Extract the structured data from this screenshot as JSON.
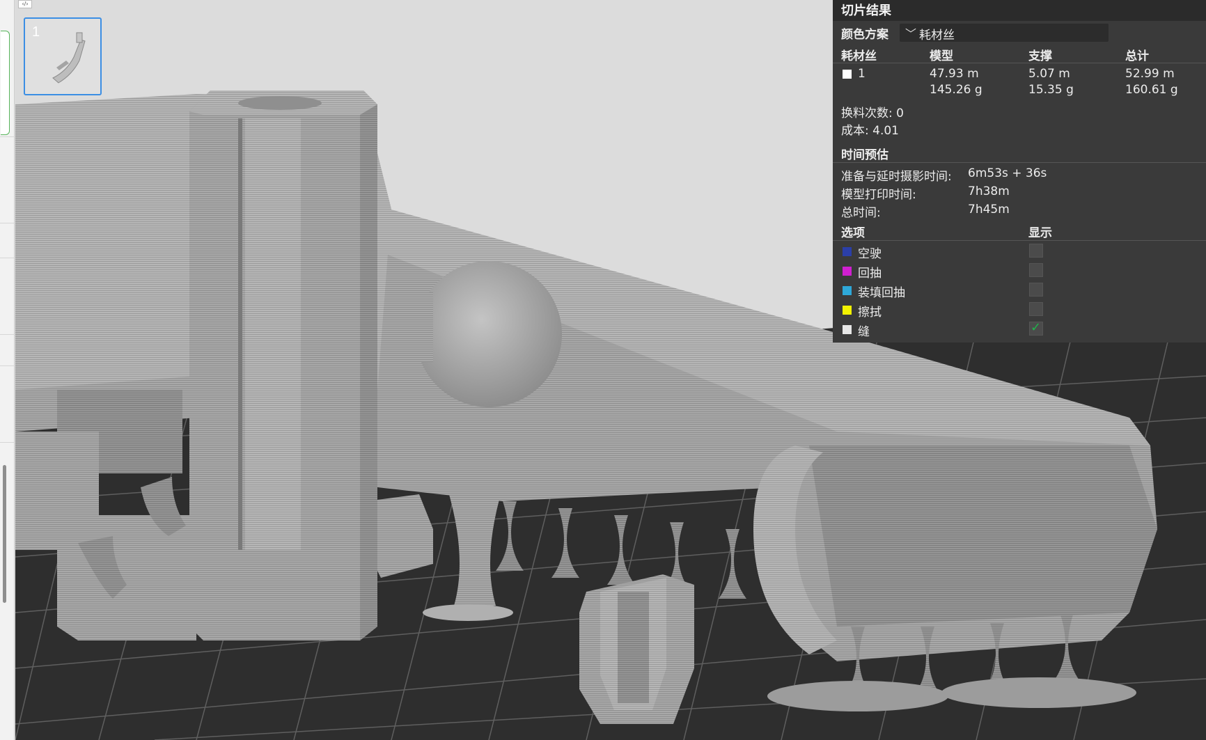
{
  "viewport": {
    "toggle_label": "‹/›",
    "plate_number": "1",
    "colors": {
      "background": "#dcdcdc",
      "bed": "#2e2e2e",
      "bed_grid": "#5f5f5f",
      "model": "#a6a6a6",
      "model_shade": "#8c8c8c",
      "model_light": "#bdbdbd"
    }
  },
  "slice_result": {
    "title": "切片结果",
    "color_scheme_label": "颜色方案",
    "color_scheme_value": "耗材丝",
    "headers": {
      "filament": "耗材丝",
      "model": "模型",
      "support": "支撑",
      "total": "总计"
    },
    "filament_row": {
      "id": "1",
      "swatch_color": "#ffffff",
      "model_length": "47.93 m",
      "model_weight": "145.26 g",
      "support_length": "5.07 m",
      "support_weight": "15.35 g",
      "total_length": "52.99 m",
      "total_weight": "160.61 g"
    },
    "filament_changes": "换料次数: 0",
    "cost": "成本: 4.01",
    "time_title": "时间预估",
    "prep_label": "准备与延时摄影时间:",
    "prep_value": "6m53s + 36s",
    "model_time_label": "模型打印时间:",
    "model_time_value": "7h38m",
    "total_time_label": "总时间:",
    "total_time_value": "7h45m",
    "options_label": "选项",
    "show_label": "显示",
    "options": [
      {
        "label": "空驶",
        "color": "#2b3fa8",
        "checked": false
      },
      {
        "label": "回抽",
        "color": "#d01fd0",
        "checked": false
      },
      {
        "label": "装填回抽",
        "color": "#2ea8d8",
        "checked": false
      },
      {
        "label": "擦拭",
        "color": "#f2f200",
        "checked": false
      },
      {
        "label": "缝",
        "color": "#e6e6e6",
        "checked": true
      }
    ]
  }
}
